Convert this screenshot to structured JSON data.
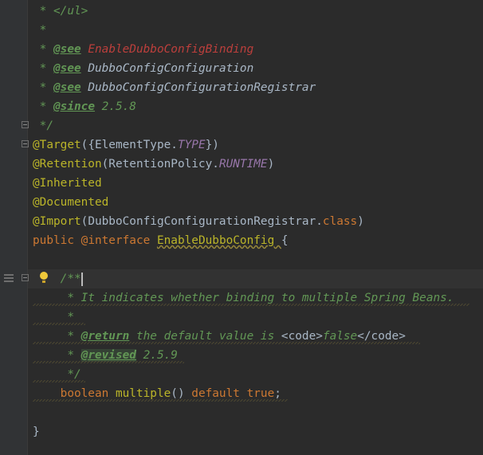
{
  "editor": {
    "lines": [
      {
        "segments": [
          {
            "t": " * </ul>",
            "c": "doc"
          }
        ]
      },
      {
        "segments": [
          {
            "t": " *",
            "c": "doc"
          }
        ]
      },
      {
        "segments": [
          {
            "t": " * ",
            "c": "doc"
          },
          {
            "t": "@see",
            "c": "doctag"
          },
          {
            "t": " ",
            "c": "doc"
          },
          {
            "t": "EnableDubboConfigBinding",
            "c": "docref-err"
          }
        ]
      },
      {
        "segments": [
          {
            "t": " * ",
            "c": "doc"
          },
          {
            "t": "@see",
            "c": "doctag"
          },
          {
            "t": " ",
            "c": "doc"
          },
          {
            "t": "DubboConfigConfiguration",
            "c": "docref"
          }
        ]
      },
      {
        "segments": [
          {
            "t": " * ",
            "c": "doc"
          },
          {
            "t": "@see",
            "c": "doctag"
          },
          {
            "t": " ",
            "c": "doc"
          },
          {
            "t": "DubboConfigConfigurationRegistrar",
            "c": "docref"
          }
        ]
      },
      {
        "segments": [
          {
            "t": " * ",
            "c": "doc"
          },
          {
            "t": "@since",
            "c": "doctag"
          },
          {
            "t": " 2.5.8",
            "c": "docval"
          }
        ]
      },
      {
        "segments": [
          {
            "t": " */",
            "c": "doc"
          }
        ]
      },
      {
        "segments": [
          {
            "t": "@Target",
            "c": "annot"
          },
          {
            "t": "({ElementType.",
            "c": "plain"
          },
          {
            "t": "TYPE",
            "c": "static"
          },
          {
            "t": "})",
            "c": "plain"
          }
        ]
      },
      {
        "segments": [
          {
            "t": "@Retention",
            "c": "annot"
          },
          {
            "t": "(RetentionPolicy.",
            "c": "plain"
          },
          {
            "t": "RUNTIME",
            "c": "static"
          },
          {
            "t": ")",
            "c": "plain"
          }
        ]
      },
      {
        "segments": [
          {
            "t": "@Inherited",
            "c": "annot"
          }
        ]
      },
      {
        "segments": [
          {
            "t": "@Documented",
            "c": "annot"
          }
        ]
      },
      {
        "segments": [
          {
            "t": "@Import",
            "c": "annot"
          },
          {
            "t": "(DubboConfigConfigurationRegistrar.",
            "c": "plain"
          },
          {
            "t": "class",
            "c": "kw"
          },
          {
            "t": ")",
            "c": "plain"
          }
        ]
      },
      {
        "segments": [
          {
            "t": "public ",
            "c": "kw"
          },
          {
            "t": "@interface ",
            "c": "kw"
          },
          {
            "t": "EnableDubboConfig ",
            "c": "annot ul"
          },
          {
            "t": "{",
            "c": "plain"
          }
        ]
      },
      {
        "segments": [
          {
            "t": "",
            "c": "plain"
          }
        ]
      },
      {
        "segments": [
          {
            "t": "    /**",
            "c": "doc"
          }
        ]
      },
      {
        "segments": [
          {
            "t": "     * It indicates whether binding to multiple Spring Beans.",
            "c": "doc"
          }
        ]
      },
      {
        "segments": [
          {
            "t": "     *",
            "c": "doc"
          }
        ]
      },
      {
        "segments": [
          {
            "t": "     * ",
            "c": "doc"
          },
          {
            "t": "@return",
            "c": "doctag"
          },
          {
            "t": " the default value is ",
            "c": "doc"
          },
          {
            "t": "<code>",
            "c": "plain"
          },
          {
            "t": "false",
            "c": "doc"
          },
          {
            "t": "</code>",
            "c": "plain"
          }
        ]
      },
      {
        "segments": [
          {
            "t": "     * ",
            "c": "doc"
          },
          {
            "t": "@revised",
            "c": "doctag revised-hl"
          },
          {
            "t": " 2.5.9",
            "c": "docval"
          }
        ]
      },
      {
        "segments": [
          {
            "t": "     */",
            "c": "doc"
          }
        ]
      },
      {
        "segments": [
          {
            "t": "    boolean ",
            "c": "kw"
          },
          {
            "t": "multiple",
            "c": "annot"
          },
          {
            "t": "() ",
            "c": "plain"
          },
          {
            "t": "default ",
            "c": "kw"
          },
          {
            "t": "true",
            "c": "kw"
          },
          {
            "t": ";",
            "c": "plain"
          }
        ]
      },
      {
        "segments": [
          {
            "t": "",
            "c": "plain"
          }
        ]
      },
      {
        "segments": [
          {
            "t": "}",
            "c": "plain"
          }
        ]
      }
    ],
    "current_line": 14
  },
  "icons": {
    "fold": "fold-marker-icon",
    "bulb": "intention-bulb-icon",
    "lines": "structure-lines-icon"
  }
}
